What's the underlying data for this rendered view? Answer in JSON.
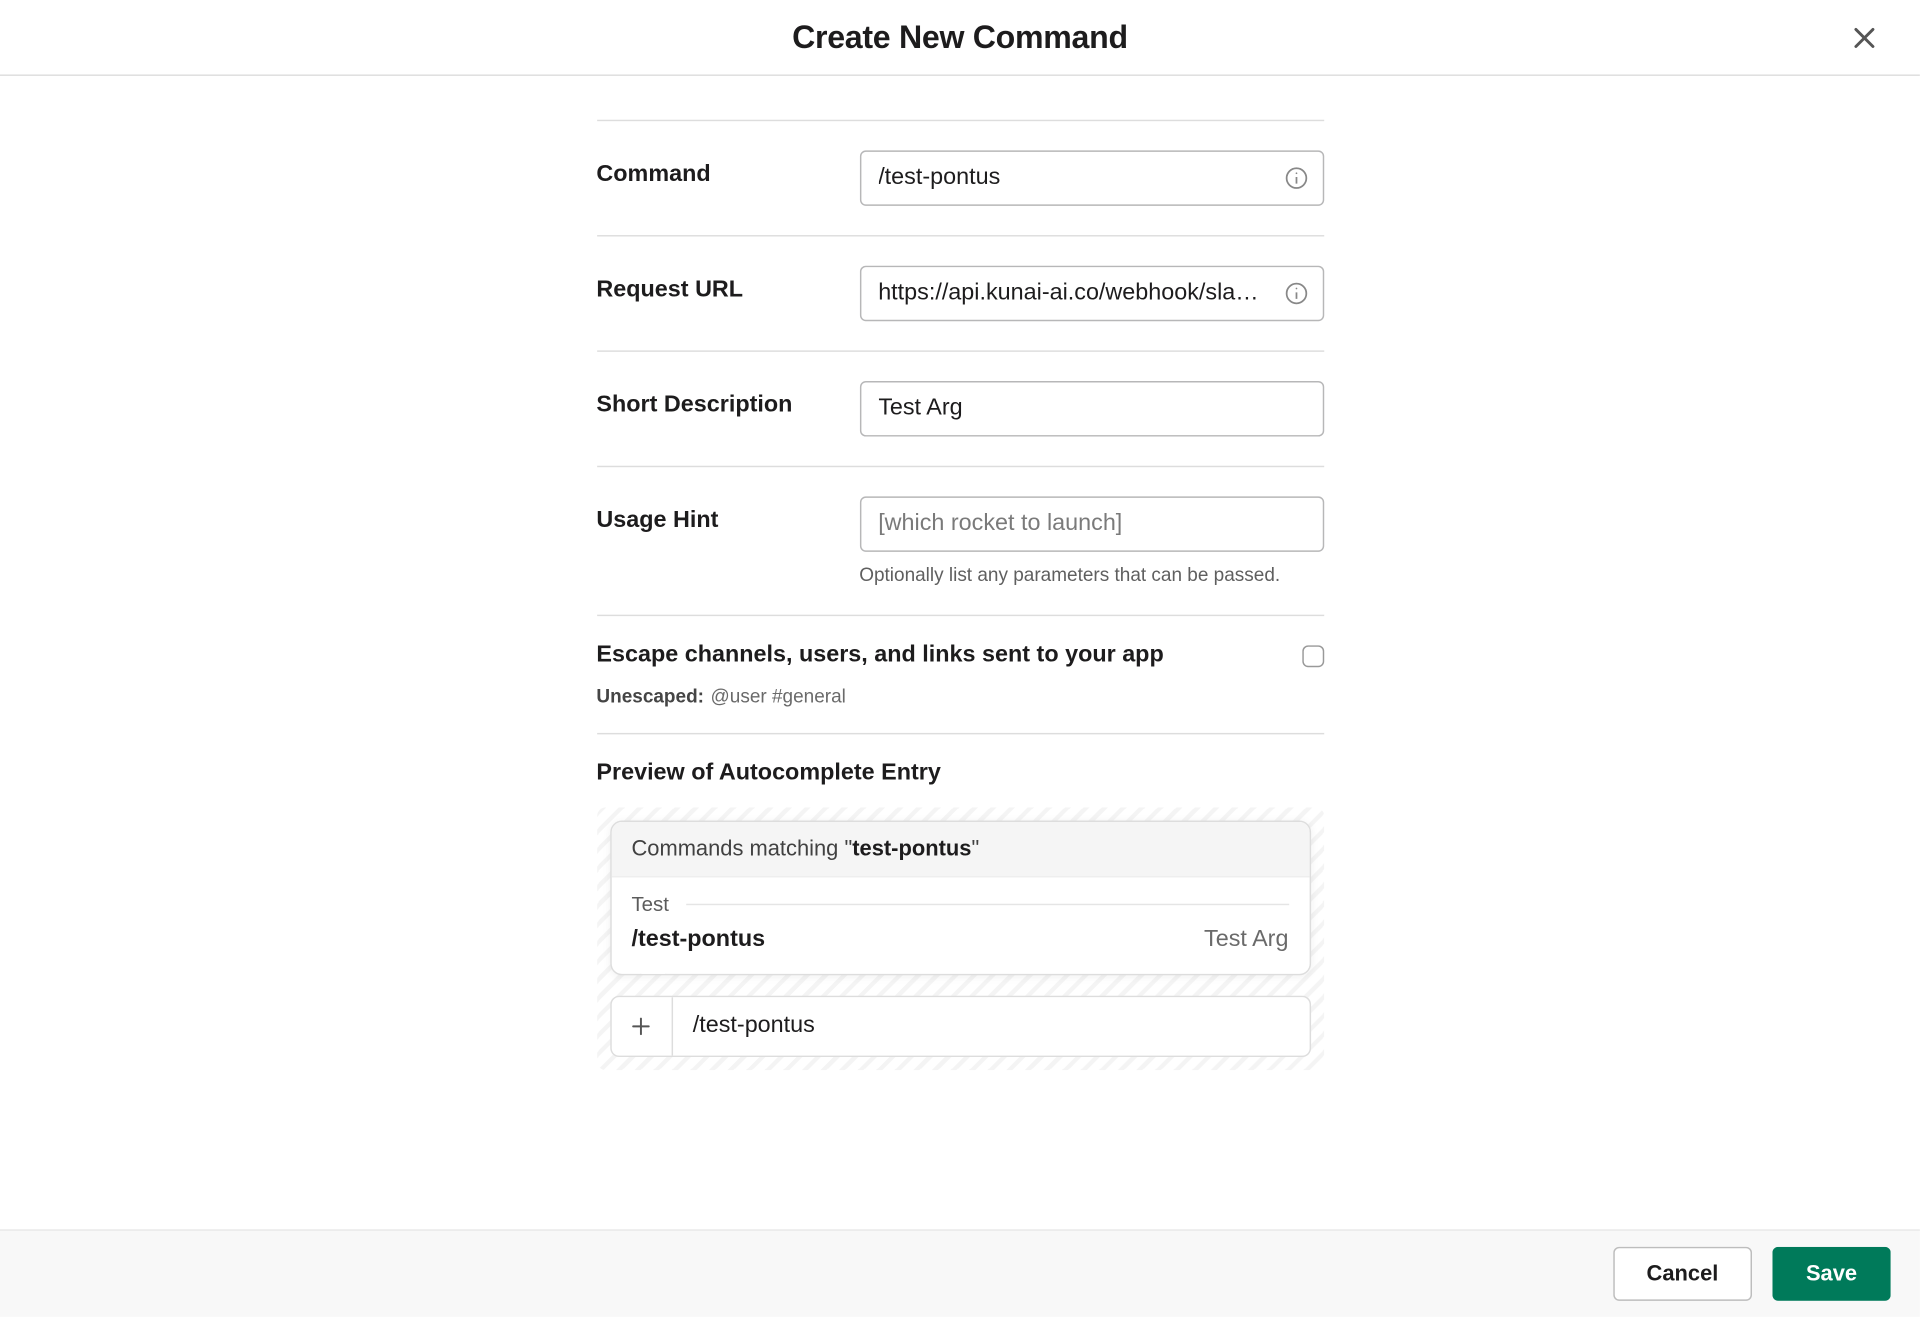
{
  "dialog": {
    "title": "Create New Command"
  },
  "form": {
    "command": {
      "label": "Command",
      "value": "/test-pontus"
    },
    "request_url": {
      "label": "Request URL",
      "value": "https://api.kunai-ai.co/webhook/sla…"
    },
    "short_description": {
      "label": "Short Description",
      "value": "Test Arg"
    },
    "usage_hint": {
      "label": "Usage Hint",
      "value": "",
      "placeholder": "[which rocket to launch]",
      "help": "Optionally list any parameters that can be passed."
    },
    "escape": {
      "title": "Escape channels, users, and links sent to your app",
      "sub_label": "Unescaped:",
      "sub_value": "@user #general",
      "checked": false
    }
  },
  "preview": {
    "title": "Preview of Autocomplete Entry",
    "matching_prefix": "Commands matching \"",
    "matching_term": "test-pontus",
    "matching_suffix": "\"",
    "group": "Test",
    "entry_command": "/test-pontus",
    "entry_description": "Test Arg",
    "composer_text": "/test-pontus"
  },
  "footer": {
    "cancel": "Cancel",
    "save": "Save"
  }
}
